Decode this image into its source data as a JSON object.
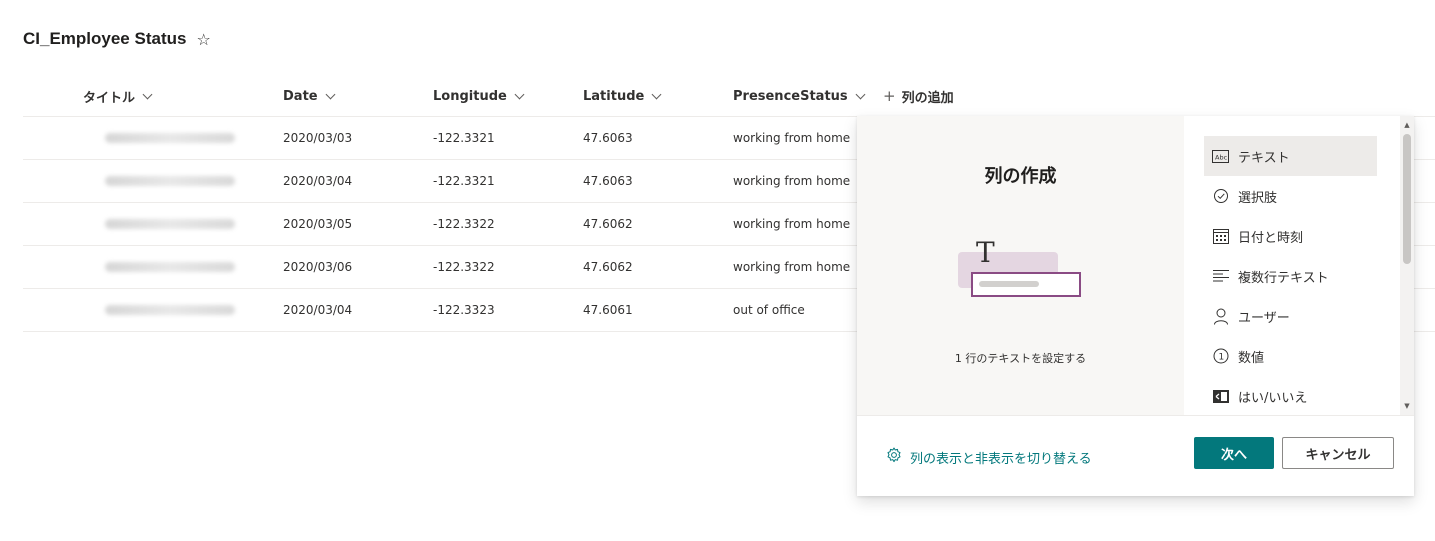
{
  "list": {
    "title": "CI_Employee Status"
  },
  "columns": [
    {
      "label": "タイトル"
    },
    {
      "label": "Date"
    },
    {
      "label": "Longitude"
    },
    {
      "label": "Latitude"
    },
    {
      "label": "PresenceStatus"
    }
  ],
  "add_column": {
    "label": "列の追加"
  },
  "rows": [
    {
      "date": "2020/03/03",
      "longitude": "-122.3321",
      "latitude": "47.6063",
      "status": "working from home"
    },
    {
      "date": "2020/03/04",
      "longitude": "-122.3321",
      "latitude": "47.6063",
      "status": "working from home"
    },
    {
      "date": "2020/03/05",
      "longitude": "-122.3322",
      "latitude": "47.6062",
      "status": "working from home"
    },
    {
      "date": "2020/03/06",
      "longitude": "-122.3322",
      "latitude": "47.6062",
      "status": "working from home"
    },
    {
      "date": "2020/03/04",
      "longitude": "-122.3323",
      "latitude": "47.6061",
      "status": "out of office"
    }
  ],
  "panel": {
    "title": "列の作成",
    "preview_description": "1 行のテキストを設定する",
    "column_types": [
      {
        "label": "テキスト",
        "icon": "text-type-icon",
        "selected": true
      },
      {
        "label": "選択肢",
        "icon": "choice-check-icon",
        "selected": false
      },
      {
        "label": "日付と時刻",
        "icon": "calendar-icon",
        "selected": false
      },
      {
        "label": "複数行テキスト",
        "icon": "multiline-text-icon",
        "selected": false
      },
      {
        "label": "ユーザー",
        "icon": "person-icon",
        "selected": false
      },
      {
        "label": "数値",
        "icon": "number-icon",
        "selected": false
      },
      {
        "label": "はい/いいえ",
        "icon": "yes-no-icon",
        "selected": false
      }
    ],
    "toggle_columns_link": "列の表示と非表示を切り替える",
    "next_button": "次へ",
    "cancel_button": "キャンセル"
  },
  "colors": {
    "accent": "#03787c",
    "selected_bg": "#edebe9",
    "preview_bg": "#f8f7f5",
    "input_border": "#8a4b84"
  }
}
